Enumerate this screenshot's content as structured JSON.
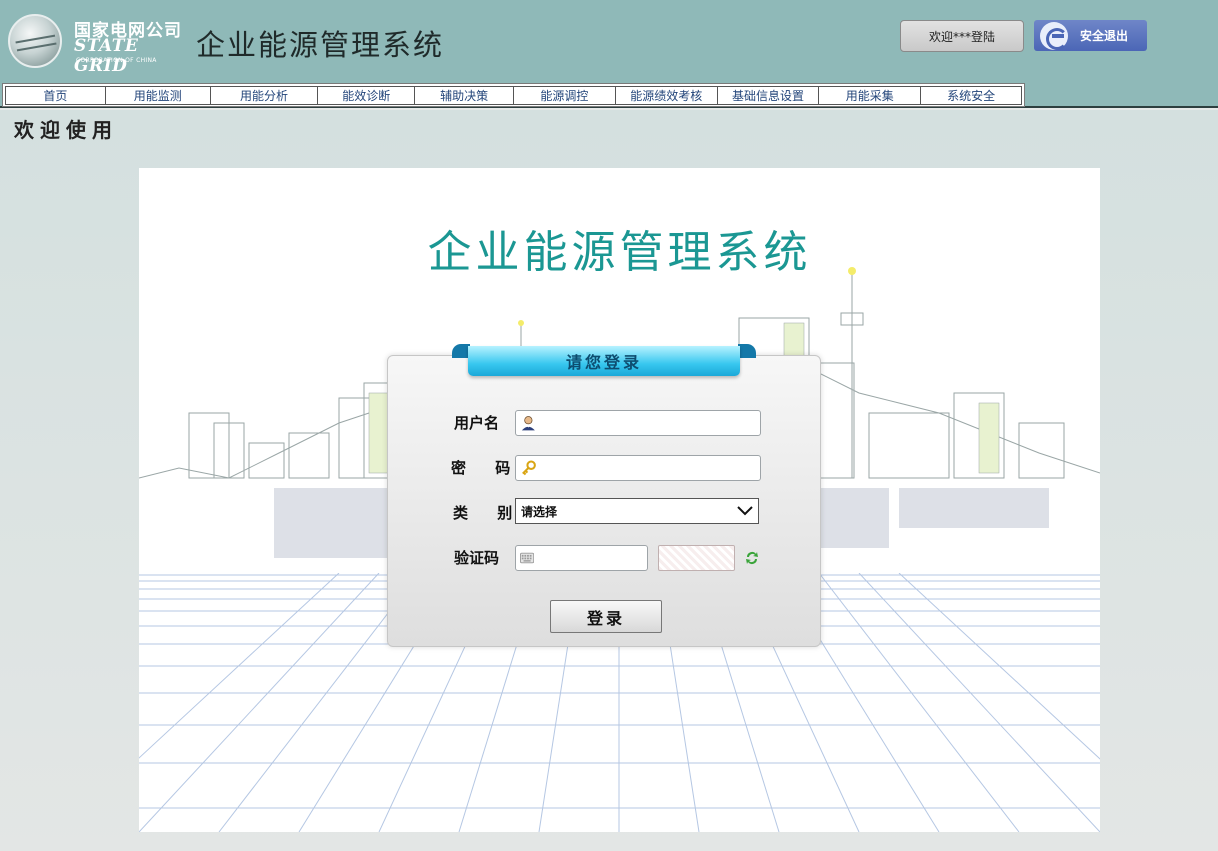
{
  "header": {
    "logo_cn": "国家电网公司",
    "logo_en": "STATE GRID",
    "logo_sub": "CORPORATION OF CHINA",
    "app_title": "企业能源管理系统",
    "welcome_text": "欢迎***登陆",
    "logout_label": "安全退出"
  },
  "nav": {
    "items": [
      {
        "label": "首页"
      },
      {
        "label": "用能监测"
      },
      {
        "label": "用能分析"
      },
      {
        "label": "能效诊断"
      },
      {
        "label": "辅助决策"
      },
      {
        "label": "能源调控"
      },
      {
        "label": "能源绩效考核"
      },
      {
        "label": "基础信息设置"
      },
      {
        "label": "用能采集"
      },
      {
        "label": "系统安全"
      }
    ]
  },
  "content": {
    "welcome_heading": "欢迎使用"
  },
  "login": {
    "stage_title": "企业能源管理系统",
    "panel_title": "请您登录",
    "username_label": "用户名",
    "password_label": "密 码",
    "category_label": "类 别",
    "category_selected": "请选择",
    "captcha_label": "验证码",
    "submit_label": "登录"
  },
  "colors": {
    "header_bg": "#8fb9b8",
    "title_teal": "#1b9793",
    "nav_text": "#23457a",
    "logout_bg": "#4b66b6",
    "ribbon": "#37c7ef"
  }
}
